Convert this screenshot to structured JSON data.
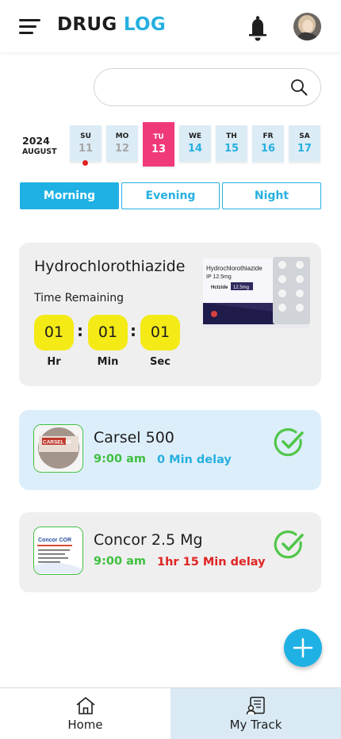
{
  "header": {
    "title_part1": "DRUG",
    "title_part2": "LOG",
    "accent_color": "#26b0e0",
    "menu_icon": "hamburger-menu-icon",
    "bell_icon": "bell-icon"
  },
  "search": {
    "placeholder": "",
    "value": ""
  },
  "calendar": {
    "year": "2024",
    "month": "AUGUST",
    "days": [
      {
        "name": "SU",
        "date": "11",
        "state": "past"
      },
      {
        "name": "MO",
        "date": "12",
        "state": "past"
      },
      {
        "name": "TU",
        "date": "13",
        "state": "selected"
      },
      {
        "name": "WE",
        "date": "14",
        "state": "future"
      },
      {
        "name": "TH",
        "date": "15",
        "state": "future"
      },
      {
        "name": "FR",
        "date": "16",
        "state": "future"
      },
      {
        "name": "SA",
        "date": "17",
        "state": "future"
      }
    ],
    "selected_color": "#f0397a"
  },
  "tabs": [
    {
      "label": "Morning",
      "active": true
    },
    {
      "label": "Evening",
      "active": false
    },
    {
      "label": "Night",
      "active": false
    }
  ],
  "current_dose": {
    "drug_name": "Hydrochlorothiazide",
    "time_label": "Time Remaining",
    "hours": "01",
    "minutes": "01",
    "seconds": "01",
    "hours_label": "Hr",
    "minutes_label": "Min",
    "seconds_label": "Sec",
    "package_text_1": "Hydrochlorothiazide",
    "package_text_2": "IP 12.5mg",
    "package_brand": "Hctzide",
    "package_strength": "12.5mg"
  },
  "doses": [
    {
      "name": "Carsel 500",
      "time": "9:00 am",
      "delay": "0 Min delay",
      "delay_color": "#26b0e0",
      "thumb_text": "CARSEL 50",
      "status_icon": "check-circle-icon"
    },
    {
      "name": "Concor 2.5 Mg",
      "time": "9:00 am",
      "delay": "1hr 15 Min delay",
      "delay_color": "#e02424",
      "thumb_text": "Concor COR",
      "status_icon": "check-circle-icon"
    }
  ],
  "bottom_nav": [
    {
      "label": "Home",
      "icon": "home-icon",
      "active": false
    },
    {
      "label": "My Track",
      "icon": "track-report-icon",
      "active": true
    }
  ]
}
